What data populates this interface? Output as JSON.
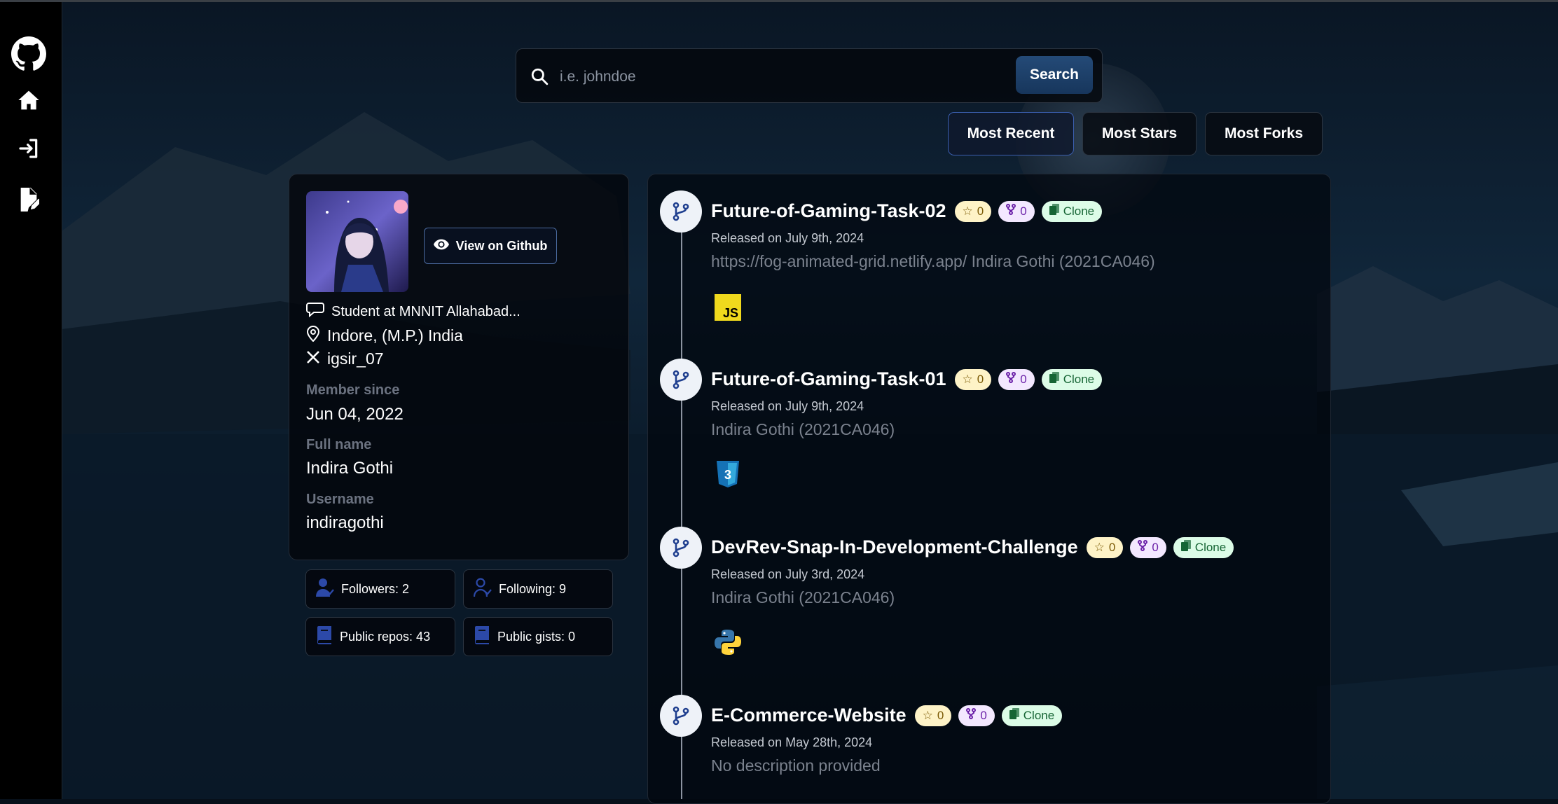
{
  "search": {
    "placeholder": "i.e. johndoe",
    "button_label": "Search"
  },
  "sort_buttons": [
    {
      "label": "Most Recent",
      "active": true
    },
    {
      "label": "Most Stars",
      "active": false
    },
    {
      "label": "Most Forks",
      "active": false
    }
  ],
  "profile": {
    "view_button": "View on Github",
    "bio": "Student at MNNIT Allahabad...",
    "location": "Indore, (M.P.) India",
    "twitter": "igsir_07",
    "member_since_label": "Member since",
    "member_since": "Jun 04, 2022",
    "full_name_label": "Full name",
    "full_name": "Indira Gothi",
    "username_label": "Username",
    "username": "indiragothi"
  },
  "stats": {
    "followers": "Followers: 2",
    "following": "Following: 9",
    "public_repos": "Public repos: 43",
    "public_gists": "Public gists: 0"
  },
  "repos": [
    {
      "name": "Future-of-Gaming-Task-02",
      "stars": "0",
      "forks": "0",
      "clone_label": "Clone",
      "released": "Released on July 9th, 2024",
      "description": "https://fog-animated-grid.netlify.app/ Indira Gothi (2021CA046)",
      "language_icon": "javascript-icon"
    },
    {
      "name": "Future-of-Gaming-Task-01",
      "stars": "0",
      "forks": "0",
      "clone_label": "Clone",
      "released": "Released on July 9th, 2024",
      "description": "Indira Gothi (2021CA046)",
      "language_icon": "css3-icon"
    },
    {
      "name": "DevRev-Snap-In-Development-Challenge",
      "stars": "0",
      "forks": "0",
      "clone_label": "Clone",
      "released": "Released on July 3rd, 2024",
      "description": "Indira Gothi (2021CA046)",
      "language_icon": "python-icon"
    },
    {
      "name": "E-Commerce-Website",
      "stars": "0",
      "forks": "0",
      "clone_label": "Clone",
      "released": "Released on May 28th, 2024",
      "description": "No description provided",
      "language_icon": "none"
    }
  ],
  "sidebar": {
    "icons": [
      "github-icon",
      "home-icon",
      "login-icon",
      "signup-icon"
    ]
  },
  "colors": {
    "accent": "#1e3f66",
    "star_badge": "#fef3c7",
    "fork_badge": "#f3e8ff",
    "clone_badge": "#dcfce7",
    "sidebar_bg": "#000000"
  }
}
